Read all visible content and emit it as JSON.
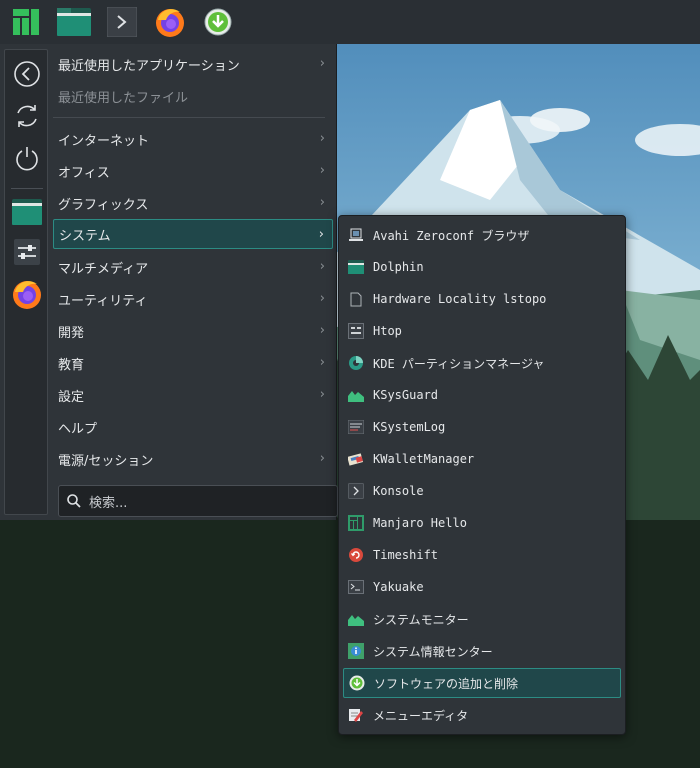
{
  "launcher": {
    "categories": [
      {
        "label": "最近使用したアプリケーション",
        "chevron": "›"
      },
      {
        "label": "最近使用したファイル",
        "chevron": ""
      },
      {
        "label": "インターネット",
        "chevron": "›"
      },
      {
        "label": "オフィス",
        "chevron": "›"
      },
      {
        "label": "グラフィックス",
        "chevron": "›"
      },
      {
        "label": "システム",
        "chevron": "›"
      },
      {
        "label": "マルチメディア",
        "chevron": "›"
      },
      {
        "label": "ユーティリティ",
        "chevron": "›"
      },
      {
        "label": "開発",
        "chevron": "›"
      },
      {
        "label": "教育",
        "chevron": "›"
      },
      {
        "label": "設定",
        "chevron": "›"
      },
      {
        "label": "ヘルプ",
        "chevron": ""
      },
      {
        "label": "電源/セッション",
        "chevron": "›"
      }
    ],
    "search_placeholder": "検索..."
  },
  "submenu": {
    "items": [
      {
        "label": "Avahi Zeroconf ブラウザ",
        "icon": "network-icon"
      },
      {
        "label": "Dolphin",
        "icon": "folder-icon"
      },
      {
        "label": "Hardware Locality lstopo",
        "icon": "document-icon"
      },
      {
        "label": "Htop",
        "icon": "htop-icon"
      },
      {
        "label": "KDE パーティションマネージャ",
        "icon": "partition-manager-icon"
      },
      {
        "label": "KSysGuard",
        "icon": "system-monitor-icon"
      },
      {
        "label": "KSystemLog",
        "icon": "log-icon"
      },
      {
        "label": "KWalletManager",
        "icon": "wallet-icon"
      },
      {
        "label": "Konsole",
        "icon": "terminal-icon"
      },
      {
        "label": "Manjaro Hello",
        "icon": "manjaro-icon"
      },
      {
        "label": "Timeshift",
        "icon": "timeshift-icon"
      },
      {
        "label": "Yakuake",
        "icon": "yakuake-icon"
      },
      {
        "label": "システムモニター",
        "icon": "system-monitor-icon"
      },
      {
        "label": "システム情報センター",
        "icon": "info-center-icon"
      },
      {
        "label": "ソフトウェアの追加と削除",
        "icon": "software-install-icon"
      },
      {
        "label": "メニューエディタ",
        "icon": "menu-editor-icon"
      }
    ]
  },
  "colors": {
    "panel_bg": "#2a2f34",
    "menu_bg": "#2f3439",
    "accent": "#2c8c84",
    "selected_bg": "#20474a",
    "manjaro_green": "#35bf5c"
  }
}
